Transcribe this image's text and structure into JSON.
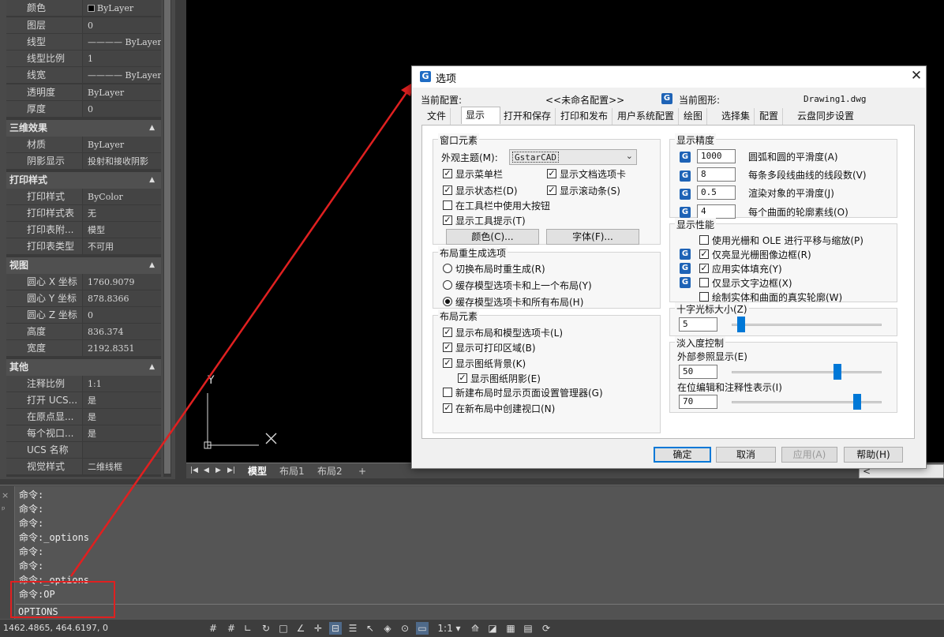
{
  "properties": {
    "general_rows": [
      {
        "key": "颜色",
        "value": "ByLayer"
      },
      {
        "key": "图层",
        "value": "0"
      },
      {
        "key": "线型",
        "value": "———— ByLayer"
      },
      {
        "key": "线型比例",
        "value": "1"
      },
      {
        "key": "线宽",
        "value": "———— ByLayer"
      },
      {
        "key": "透明度",
        "value": "ByLayer"
      },
      {
        "key": "厚度",
        "value": "0"
      }
    ],
    "section_3d": "三维效果",
    "rows_3d": [
      {
        "key": "材质",
        "value": "ByLayer"
      },
      {
        "key": "阴影显示",
        "value": "投射和接收阴影"
      }
    ],
    "section_plot": "打印样式",
    "rows_plot": [
      {
        "key": "打印样式",
        "value": "ByColor"
      },
      {
        "key": "打印样式表",
        "value": "无"
      },
      {
        "key": "打印表附...",
        "value": "模型"
      },
      {
        "key": "打印表类型",
        "value": "不可用"
      }
    ],
    "section_view": "视图",
    "rows_view": [
      {
        "key": "圆心 X 坐标",
        "value": "1760.9079"
      },
      {
        "key": "圆心 Y 坐标",
        "value": "878.8366"
      },
      {
        "key": "圆心 Z 坐标",
        "value": "0"
      },
      {
        "key": "高度",
        "value": "836.374"
      },
      {
        "key": "宽度",
        "value": "2192.8351"
      }
    ],
    "section_misc": "其他",
    "rows_misc": [
      {
        "key": "注释比例",
        "value": "1:1"
      },
      {
        "key": "打开 UCS...",
        "value": "是"
      },
      {
        "key": "在原点显...",
        "value": "是"
      },
      {
        "key": "每个视口...",
        "value": "是"
      },
      {
        "key": "UCS 名称",
        "value": ""
      },
      {
        "key": "视觉样式",
        "value": "二维线框"
      }
    ]
  },
  "canvas": {
    "ucs_y": "Y"
  },
  "layout_tabs": {
    "model": "模型",
    "layout1": "布局1",
    "layout2": "布局2",
    "add": "+"
  },
  "command": {
    "history": [
      "命令:",
      "命令:",
      "命令:",
      "命令:_options",
      "命令:",
      "命令:",
      "命令:_options",
      "命令:OP"
    ],
    "input": "OPTIONS"
  },
  "status": {
    "coords": "1462.4865, 464.6197, 0",
    "annotation_scale": "1:1"
  },
  "dialog": {
    "title": "选项",
    "current_profile_label": "当前配置:",
    "current_profile_value": "<<未命名配置>>",
    "current_drawing_label": "当前图形:",
    "current_drawing_value": "Drawing1.dwg",
    "tabs": [
      "文件",
      "显示",
      "打开和保存",
      "打印和发布",
      "用户系统配置",
      "绘图",
      "选择集",
      "配置",
      "云盘同步设置"
    ],
    "selected_tab": "显示",
    "window_elements": {
      "title": "窗口元素",
      "theme_label": "外观主题(M):",
      "theme_value": "GstarCAD",
      "show_menubar": "显示菜单栏",
      "show_doc_tabs": "显示文档选项卡",
      "show_statusbar": "显示状态栏(D)",
      "show_scrollbars": "显示滚动条(S)",
      "large_buttons": "在工具栏中使用大按钮",
      "show_tooltips": "显示工具提示(T)",
      "colors_button": "颜色(C)...",
      "fonts_button": "字体(F)..."
    },
    "layout_regen": {
      "title": "布局重生成选项",
      "opt1": "切换布局时重生成(R)",
      "opt2": "缓存模型选项卡和上一个布局(Y)",
      "opt3": "缓存模型选项卡和所有布局(H)"
    },
    "layout_elements": {
      "title": "布局元素",
      "show_layout_tabs": "显示布局和模型选项卡(L)",
      "show_printable": "显示可打印区域(B)",
      "show_paper_bg": "显示图纸背景(K)",
      "show_paper_shadow": "显示图纸阴影(E)",
      "show_page_setup": "新建布局时显示页面设置管理器(G)",
      "create_viewport": "在新布局中创建视口(N)"
    },
    "display_resolution": {
      "title": "显示精度",
      "arc_value": "1000",
      "arc_label": "圆弧和圆的平滑度(A)",
      "pline_value": "8",
      "pline_label": "每条多段线曲线的线段数(V)",
      "render_value": "0.5",
      "render_label": "渲染对象的平滑度(J)",
      "contour_value": "4",
      "contour_label": "每个曲面的轮廓素线(O)"
    },
    "display_performance": {
      "title": "显示性能",
      "pan_zoom": "使用光栅和 OLE 进行平移与缩放(P)",
      "raster_frame": "仅亮显光栅图像边框(R)",
      "solid_fill": "应用实体填充(Y)",
      "text_frame": "仅显示文字边框(X)",
      "true_silhouettes": "绘制实体和曲面的真实轮廓(W)"
    },
    "crosshair": {
      "title": "十字光标大小(Z)",
      "value": "5",
      "level": 5
    },
    "fade": {
      "title": "淡入度控制",
      "xref_label": "外部参照显示(E)",
      "xref_value": "50",
      "xref_level": 50,
      "inplace_label": "在位编辑和注释性表示(I)",
      "inplace_value": "70",
      "inplace_level": 70
    },
    "buttons": {
      "ok": "确定",
      "cancel": "取消",
      "apply": "应用(A)",
      "help": "帮助(H)"
    }
  },
  "colors": {
    "annotation_red": "#e02020",
    "accent_blue": "#0078d7"
  }
}
